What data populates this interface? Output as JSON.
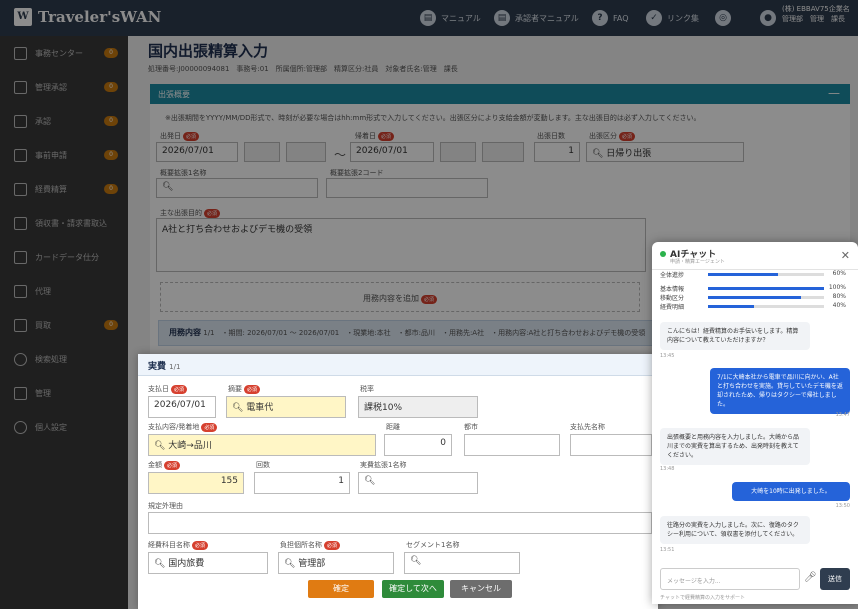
{
  "header": {
    "logo": "Traveler'sWAN",
    "links": [
      {
        "label": "マニュアル",
        "icon": "book-icon"
      },
      {
        "label": "承認者マニュアル",
        "icon": "book-icon"
      },
      {
        "label": "FAQ",
        "icon": "help-icon"
      },
      {
        "label": "リンク集",
        "icon": "check-icon"
      },
      {
        "label": "",
        "icon": "globe-icon"
      }
    ],
    "company": "(株) EBBAV75企業名",
    "user": "管理部　管理　課長"
  },
  "sidebar": {
    "items": [
      {
        "label": "事務センター",
        "badge": "0"
      },
      {
        "label": "管理承認",
        "badge": "0"
      },
      {
        "label": "承認",
        "badge": "0"
      },
      {
        "label": "事前申請",
        "badge": "0"
      },
      {
        "label": "経費精算",
        "badge": "0"
      },
      {
        "label": "領収書・請求書取込",
        "badge": ""
      },
      {
        "label": "カードデータ仕分",
        "badge": ""
      },
      {
        "label": "代理",
        "badge": ""
      },
      {
        "label": "買取",
        "badge": "0"
      },
      {
        "label": "検索処理",
        "badge": ""
      },
      {
        "label": "管理",
        "badge": ""
      },
      {
        "label": "個人設定",
        "badge": ""
      }
    ]
  },
  "page": {
    "title": "国内出張精算入力",
    "info": "処理番号:J00000094081　事務号:01　所属個所:管理部　精算区分:社員　対象者氏名:管理　課長"
  },
  "section": {
    "title": "出張概要",
    "collapse": "—",
    "note": "※出張期間をYYYY/MM/DD形式で、時刻が必要な場合はhh:mm形式で入力してください。出張区分により支給金額が変動します。主な出張目的は必ず入力してください。",
    "start_label": "出発日",
    "start_value": "2026/07/01",
    "end_label": "帰着日",
    "end_value": "2026/07/01",
    "tilde": "〜",
    "days_label": "出張日数",
    "days_value": "1",
    "type_label": "出張区分",
    "type_value": "日帰り出張",
    "ext1_label": "概要拡張1名称",
    "ext2_label": "概要拡張2コード",
    "purpose_label": "主な出張目的",
    "purpose_value": "A社と打ち合わせおよびデモ機の受領",
    "add_detail": "用務内容を追加",
    "detail_title": "用務内容",
    "detail_count": "1/1",
    "detail_text": "・期間: 2026/07/01 〜 2026/07/01　・現業地:本社　・都市:品川　・用務先:A社　・用務内容:A社と打ち合わせおよびデモ機の受領"
  },
  "req": "必須",
  "dialog": {
    "title": "実費",
    "count": "1/1",
    "date_label": "支払日",
    "date_value": "2026/07/01",
    "summary_label": "摘要",
    "summary_value": "電車代",
    "tax_label": "税率",
    "tax_value": "課税10%",
    "route_label": "支払内容/発着地",
    "route_value": "大崎→品川",
    "distance_label": "距離",
    "distance_value": "0",
    "city_label": "都市",
    "payee_label": "支払先名称",
    "amount_label": "金額",
    "amount_value": "155",
    "times_label": "回数",
    "times_value": "1",
    "ext_label": "実費拡張1名称",
    "reason_label": "規定外理由",
    "account_label": "経費科目名称",
    "account_value": "国内旅費",
    "dept_label": "負担個所名称",
    "dept_value": "管理部",
    "seg_label": "セグメント1名称",
    "confirm": "確定",
    "confirm_next": "確定して次へ",
    "cancel": "キャンセル"
  },
  "chat": {
    "title": "AIチャット",
    "subtitle": "申請・精算エージェント",
    "progress": [
      {
        "label": "全体進捗",
        "value": "60%",
        "pct": 60
      },
      {
        "label": "基本情報",
        "value": "100%",
        "pct": 100
      },
      {
        "label": "移動区分",
        "value": "80%",
        "pct": 80
      },
      {
        "label": "経費明細",
        "value": "40%",
        "pct": 40
      }
    ],
    "messages": [
      {
        "role": "bot",
        "text": "こんにちは！経費精算のお手伝いをします。精算内容について教えていただけますか？",
        "time": "13:45"
      },
      {
        "role": "usr",
        "text": "7/1に大崎本社から電車で品川に向かい、A社と打ち合わせを実施。貸与していたデモ機を返却されたため、帰りはタクシーで帰社しました。",
        "time": "13:47"
      },
      {
        "role": "bot",
        "text": "出張概要と用務内容を入力しました。大崎から品川までの実費を算出するため、出発時刻を教えてください。",
        "time": "13:48"
      },
      {
        "role": "usr",
        "text": "大崎を10時に出発しました。",
        "time": "13:50"
      },
      {
        "role": "bot",
        "text": "往路分の実費を入力しました。次に、復路のタクシー利用について、領収書を添付してください。",
        "time": "13:51"
      }
    ],
    "input_placeholder": "メッセージを入力...",
    "send": "送信",
    "footer": "チャットで経費精算の入力をサポート"
  }
}
